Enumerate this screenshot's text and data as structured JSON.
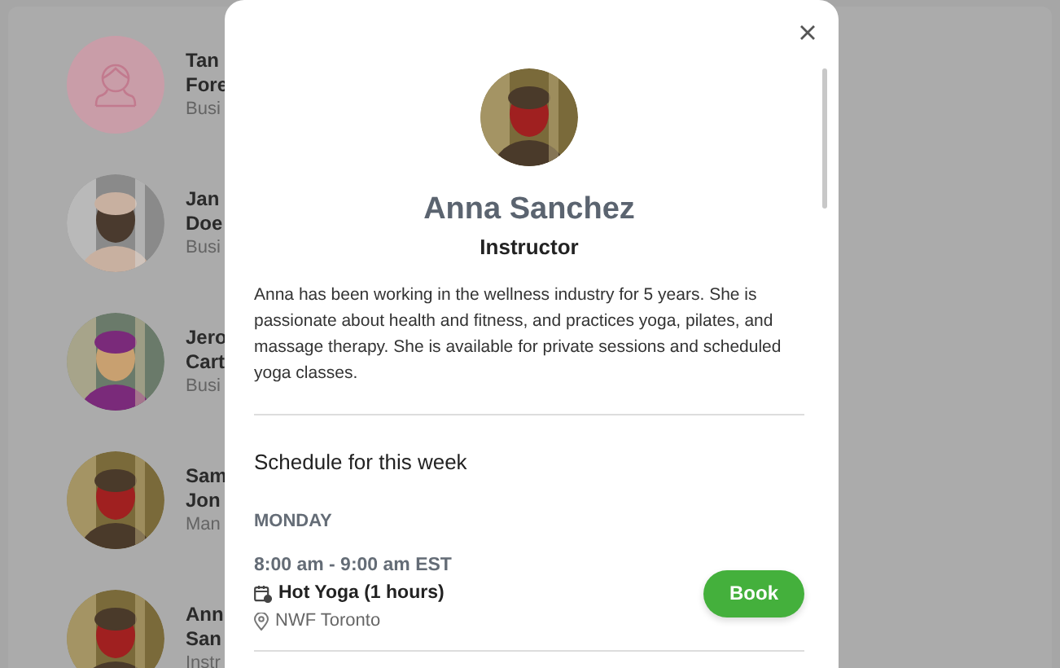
{
  "background_list": [
    {
      "kind": "icon",
      "name_lines": [
        "Tan",
        "Fore"
      ],
      "role": "Busi"
    },
    {
      "kind": "picture",
      "name_lines": [
        "Jan",
        "Doe"
      ],
      "role": "Busi"
    },
    {
      "kind": "picture",
      "name_lines": [
        "Jero",
        "Cart"
      ],
      "role": "Busi"
    },
    {
      "kind": "picture",
      "name_lines": [
        "Sam",
        "Jon"
      ],
      "role": "Man"
    },
    {
      "kind": "picture",
      "name_lines": [
        "Ann",
        "San"
      ],
      "role": "Instr"
    }
  ],
  "modal": {
    "name": "Anna Sanchez",
    "title": "Instructor",
    "bio": "Anna has been working in the wellness industry for 5 years. She is passionate about health and fitness, and practices yoga, pilates, and massage therapy. She is available for private sessions and scheduled yoga classes.",
    "schedule_heading": "Schedule for this week",
    "days": [
      {
        "day": "MONDAY",
        "sessions": [
          {
            "time": "8:00 am - 9:00 am EST",
            "class": "Hot Yoga (1 hours)",
            "location": "NWF Toronto",
            "button": "Book"
          }
        ]
      }
    ]
  }
}
